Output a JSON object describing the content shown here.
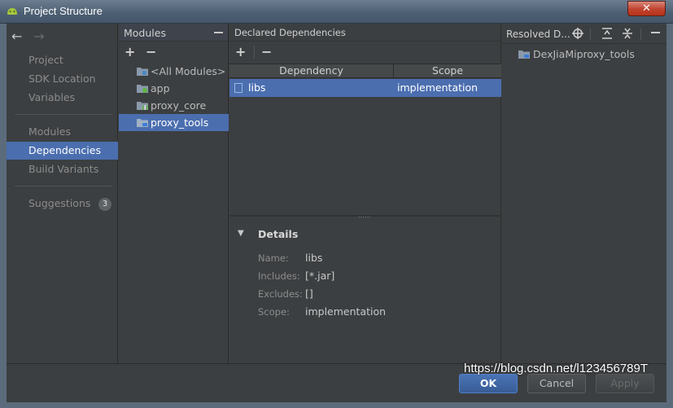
{
  "window": {
    "title": "Project Structure",
    "close_glyph": "✕"
  },
  "nav": {
    "back_glyph": "←",
    "forward_glyph": "→",
    "items": [
      {
        "label": "Project"
      },
      {
        "label": "SDK Location"
      },
      {
        "label": "Variables"
      },
      {
        "label": "Modules"
      },
      {
        "label": "Dependencies"
      },
      {
        "label": "Build Variants"
      },
      {
        "label": "Suggestions",
        "badge": "3"
      }
    ]
  },
  "modules": {
    "title": "Modules",
    "add_glyph": "+",
    "remove_glyph": "−",
    "items": [
      {
        "label": "<All Modules>"
      },
      {
        "label": "app"
      },
      {
        "label": "proxy_core"
      },
      {
        "label": "proxy_tools"
      }
    ]
  },
  "declared": {
    "title": "Declared Dependencies",
    "add_glyph": "+",
    "remove_glyph": "−",
    "columns": {
      "dependency": "Dependency",
      "scope": "Scope"
    },
    "rows": [
      {
        "dependency": "libs",
        "scope": "implementation"
      }
    ],
    "details": {
      "title": "Details",
      "name_label": "Name:",
      "name_value": "libs",
      "includes_label": "Includes:",
      "includes_value": "[*.jar]",
      "excludes_label": "Excludes:",
      "excludes_value": "[]",
      "scope_label": "Scope:",
      "scope_value": "implementation"
    }
  },
  "resolved": {
    "title": "Resolved D...",
    "items": [
      {
        "label": "DexJiaMiproxy_tools"
      }
    ]
  },
  "buttons": {
    "ok": "OK",
    "cancel": "Cancel",
    "apply": "Apply"
  },
  "watermark": "https://blog.csdn.net/l123456789T",
  "colors": {
    "selection": "#4b6eaf",
    "background": "#3c3f41"
  }
}
